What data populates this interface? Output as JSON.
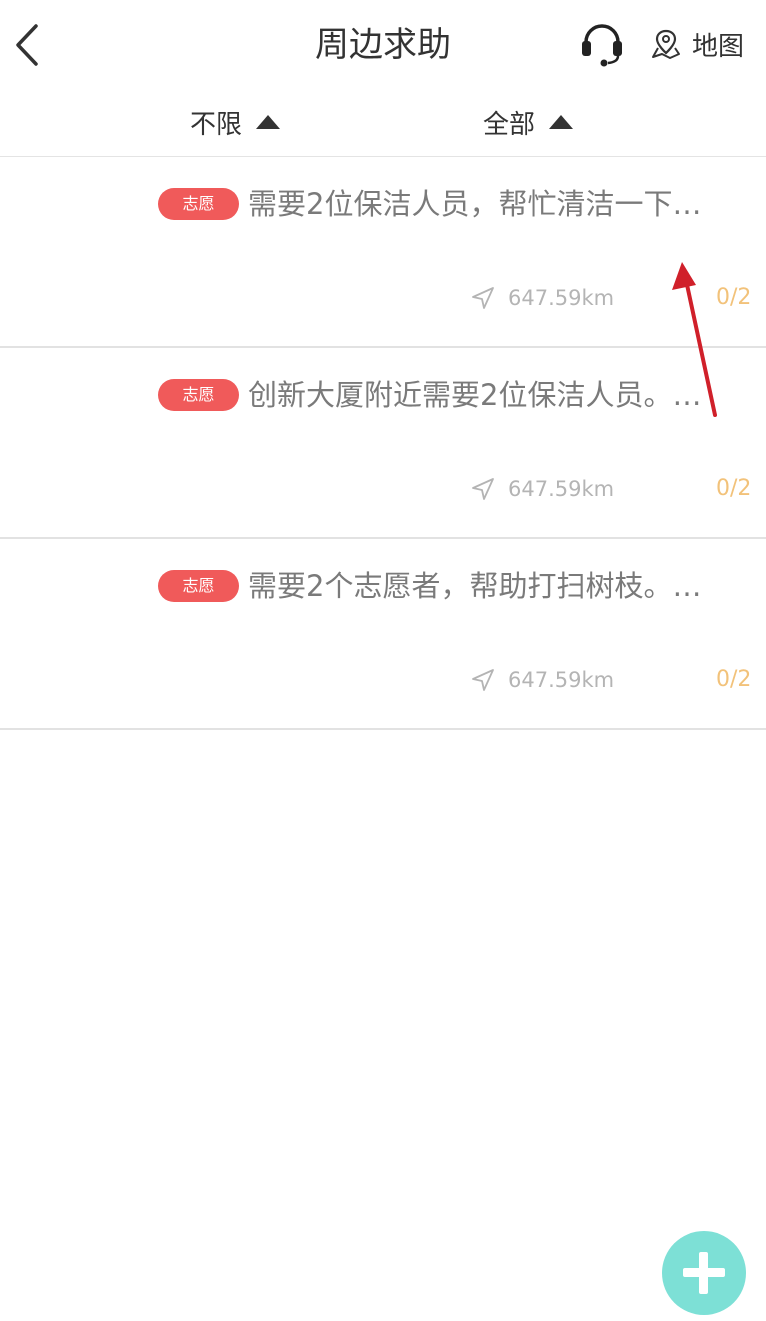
{
  "header": {
    "title": "周边求助",
    "map_label": "地图"
  },
  "filters": [
    {
      "label": "不限"
    },
    {
      "label": "全部"
    }
  ],
  "items": [
    {
      "tag": "志愿",
      "title": "需要2位保洁人员，帮忙清洁一下…",
      "distance": "647.59km",
      "count": "0/2"
    },
    {
      "tag": "志愿",
      "title": "创新大厦附近需要2位保洁人员。…",
      "distance": "647.59km",
      "count": "0/2"
    },
    {
      "tag": "志愿",
      "title": "需要2个志愿者，帮助打扫树枝。…",
      "distance": "647.59km",
      "count": "0/2"
    }
  ],
  "icons": {
    "back": "chevron-left-icon",
    "service": "headset-icon",
    "map": "map-pin-icon",
    "distance": "navigation-arrow-icon",
    "add": "plus-icon"
  },
  "colors": {
    "tag_bg": "#f05a5a",
    "count": "#f2c27a",
    "fab": "#7de0d6",
    "annotation": "#d0202a"
  }
}
